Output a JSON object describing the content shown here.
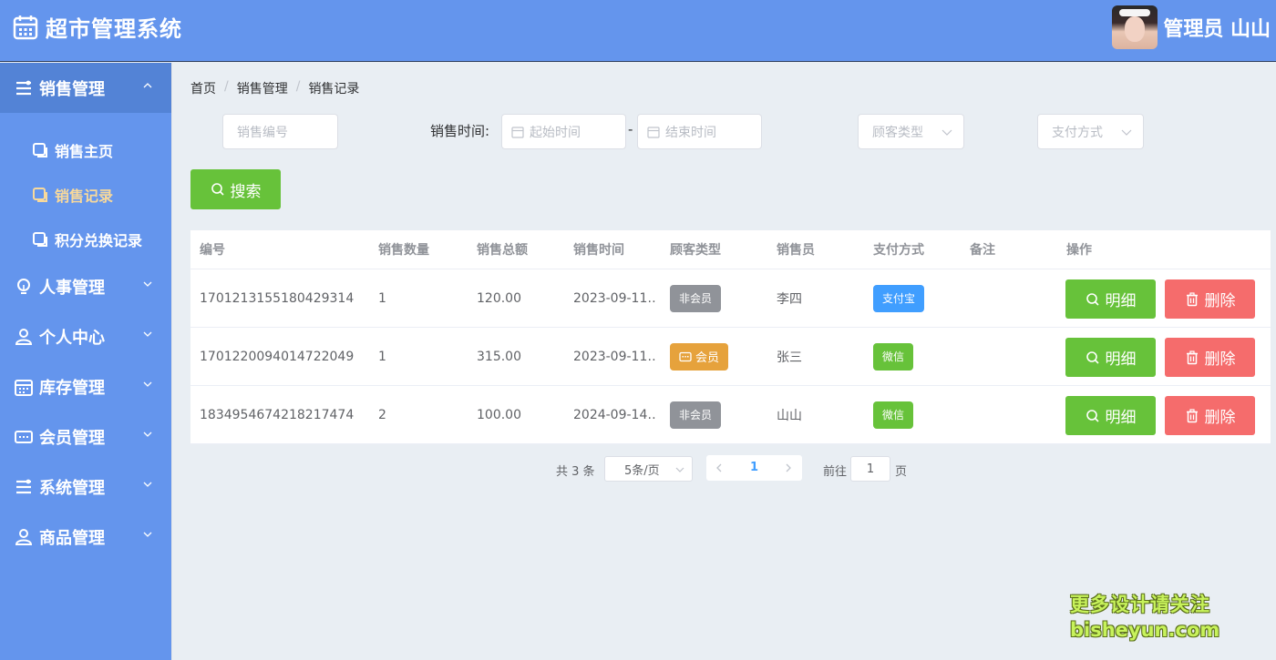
{
  "app": {
    "title": "超市管理系统"
  },
  "user": {
    "name": "管理员 山山"
  },
  "sidebar": {
    "items": [
      {
        "label": "销售管理",
        "icon": "menu-icon",
        "open": true
      },
      {
        "label": "人事管理",
        "icon": "bulb-icon"
      },
      {
        "label": "个人中心",
        "icon": "user-icon"
      },
      {
        "label": "库存管理",
        "icon": "calendar-icon"
      },
      {
        "label": "会员管理",
        "icon": "card-icon"
      },
      {
        "label": "系统管理",
        "icon": "menu-icon"
      },
      {
        "label": "商品管理",
        "icon": "user-icon"
      }
    ],
    "sub_items": [
      {
        "label": "销售主页"
      },
      {
        "label": "销售记录",
        "active": true
      },
      {
        "label": "积分兑换记录"
      }
    ]
  },
  "breadcrumb": [
    "首页",
    "销售管理",
    "销售记录"
  ],
  "filters": {
    "sale_no_placeholder": "销售编号",
    "time_label": "销售时间:",
    "start_placeholder": "起始时间",
    "range_sep": "-",
    "end_placeholder": "结束时间",
    "customer_type_placeholder": "顾客类型",
    "payment_placeholder": "支付方式",
    "search_label": "搜索"
  },
  "table": {
    "headers": [
      "编号",
      "销售数量",
      "销售总额",
      "销售时间",
      "顾客类型",
      "销售员",
      "支付方式",
      "备注",
      "操作"
    ],
    "rows": [
      {
        "id": "1701213155180429314",
        "qty": "1",
        "total": "120.00",
        "time": "2023-09-11…",
        "customer": "非会员",
        "seller": "李四",
        "payment": "支付宝",
        "note": ""
      },
      {
        "id": "1701220094014722049",
        "qty": "1",
        "total": "315.00",
        "time": "2023-09-11…",
        "customer": "会员",
        "seller": "张三",
        "payment": "微信",
        "note": ""
      },
      {
        "id": "1834954674218217474",
        "qty": "2",
        "total": "100.00",
        "time": "2024-09-14…",
        "customer": "非会员",
        "seller": "山山",
        "payment": "微信",
        "note": ""
      }
    ],
    "detail_label": "明细",
    "delete_label": "删除"
  },
  "pagination": {
    "total_text": "共 3 条",
    "page_size": "5条/页",
    "current_page": "1",
    "goto_label": "前往",
    "goto_value": "1",
    "page_suffix": "页"
  },
  "watermark": {
    "line1": "更多设计请关注",
    "line2": "bisheyun.com"
  },
  "colors": {
    "primary": "#6495ed",
    "success": "#67c23a",
    "danger": "#f56c6c",
    "warning": "#e6a23c",
    "info": "#909399",
    "active_text": "#f8d99b"
  }
}
